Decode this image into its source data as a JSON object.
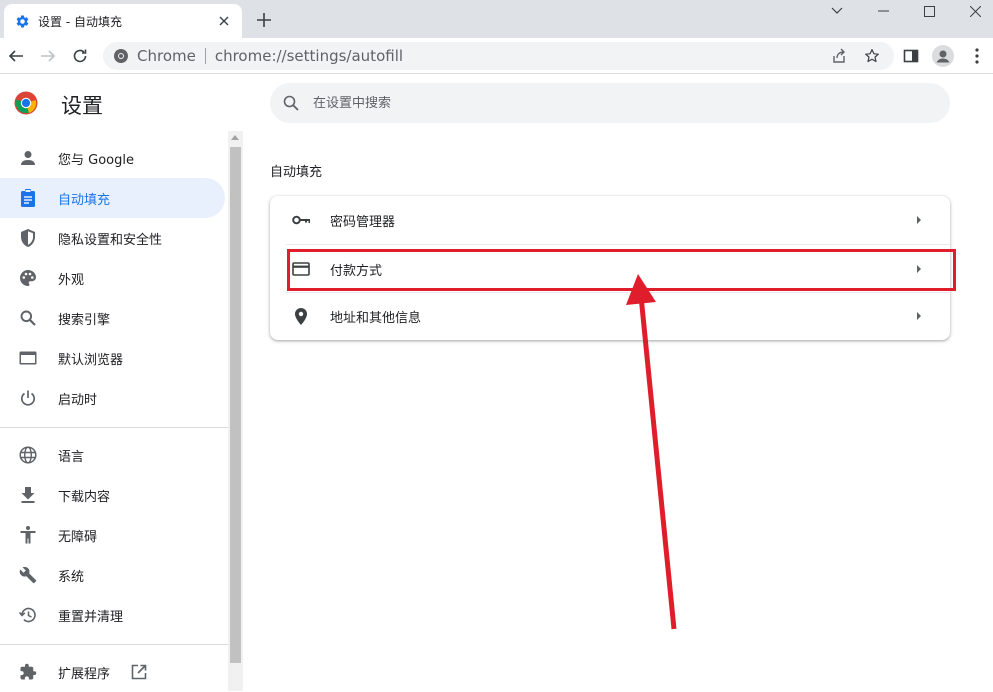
{
  "tab": {
    "title": "设置 - 自动填充",
    "favicon": "gear-icon"
  },
  "toolbar": {
    "site_name": "Chrome",
    "url": "chrome://settings/autofill"
  },
  "header": {
    "title": "设置",
    "search_placeholder": "在设置中搜索"
  },
  "sidebar": {
    "items": [
      {
        "label": "您与 Google",
        "icon": "person-icon"
      },
      {
        "label": "自动填充",
        "icon": "autofill-icon",
        "active": true
      },
      {
        "label": "隐私设置和安全性",
        "icon": "shield-icon"
      },
      {
        "label": "外观",
        "icon": "palette-icon"
      },
      {
        "label": "搜索引擎",
        "icon": "search-icon"
      },
      {
        "label": "默认浏览器",
        "icon": "browser-icon"
      },
      {
        "label": "启动时",
        "icon": "power-icon"
      },
      {
        "label": "语言",
        "icon": "globe-icon"
      },
      {
        "label": "下载内容",
        "icon": "download-icon"
      },
      {
        "label": "无障碍",
        "icon": "accessibility-icon"
      },
      {
        "label": "系统",
        "icon": "wrench-icon"
      },
      {
        "label": "重置并清理",
        "icon": "restore-icon"
      },
      {
        "label": "扩展程序",
        "icon": "puzzle-icon"
      }
    ]
  },
  "main": {
    "section_title": "自动填充",
    "rows": [
      {
        "label": "密码管理器",
        "icon": "key-icon"
      },
      {
        "label": "付款方式",
        "icon": "credit-card-icon"
      },
      {
        "label": "地址和其他信息",
        "icon": "location-pin-icon"
      }
    ]
  },
  "colors": {
    "accent": "#1a73e8",
    "active_bg": "#e8f0fe",
    "annotation_red": "#e01d2b"
  }
}
